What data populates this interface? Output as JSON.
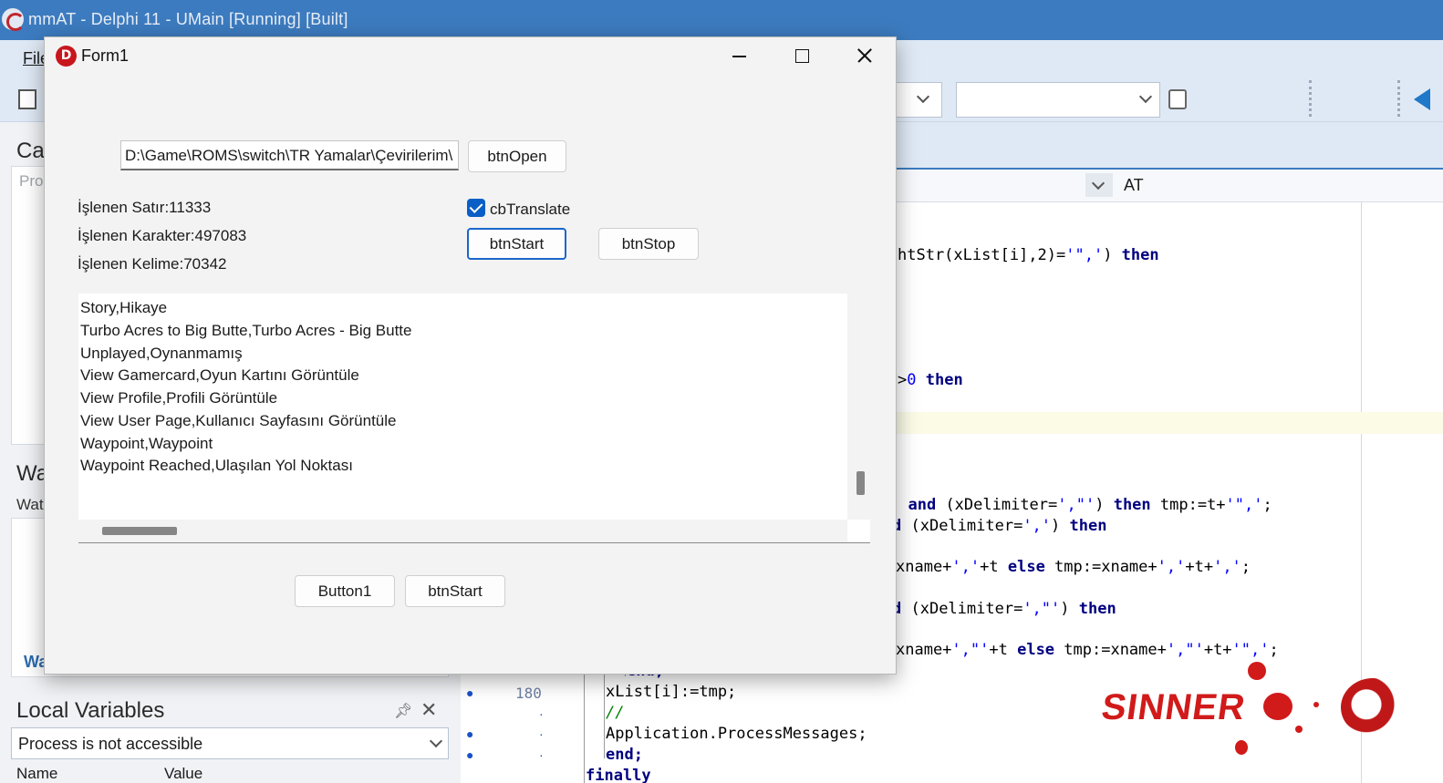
{
  "ide": {
    "title": "mmAT - Delphi 11 - UMain [Running] [Built]",
    "menu": {
      "file": "File"
    },
    "left_panel": {
      "cal_label": "Cal",
      "cal_placeholder": "Pro",
      "wa_label": "Wa",
      "wat_label": "Wat",
      "wa_tab": "Wa",
      "local_variables_title": "Local Variables",
      "process_status": "Process is not accessible",
      "col_name": "Name",
      "col_value": "Value"
    },
    "editor": {
      "nav_value": "AT",
      "line_number": "180",
      "code": {
        "l1_a": "htStr(xList[i],2)=",
        "l1_b": "'\",'",
        "l1_c": ") ",
        "l1_d": "then",
        "l2_a": ">",
        "l2_b": "0",
        "l2_c": " ",
        "l2_d": "then",
        "l3_a": ") ",
        "l3_b": "and",
        "l3_c": " (xDelimiter=",
        "l3_d": "',\"'",
        "l3_e": ") ",
        "l3_f": "then",
        "l3_g": " tmp:=t+",
        "l3_h": "'\",'",
        "l3_i": ";",
        "l4_a": "d",
        "l4_b": " (xDelimiter=",
        "l4_c": "','",
        "l4_d": ") ",
        "l4_e": "then",
        "l5_a": "xname+",
        "l5_b": "','",
        "l5_c": "+t ",
        "l5_d": "else",
        "l5_e": " tmp:=xname+",
        "l5_f": "','",
        "l5_g": "+t+",
        "l5_h": "','",
        "l5_i": ";",
        "l6_a": "d",
        "l6_b": " (xDelimiter=",
        "l6_c": "',\"'",
        "l6_d": ") ",
        "l6_e": "then",
        "l7_a": "xname+",
        "l7_b": "',\"'",
        "l7_c": "+t ",
        "l7_d": "else",
        "l7_e": " tmp:=xname+",
        "l7_f": "',\"'",
        "l7_g": "+t+",
        "l7_h": "'\",'",
        "l7_i": ";",
        "l8": "end;",
        "l9": "xList[i]:=tmp;",
        "l10": "//",
        "l11": "Application.ProcessMessages;",
        "l12": "end;",
        "l13": "finally"
      }
    },
    "watermark": "SINNER",
    "colors": {
      "ide_title": "#3c7bbf",
      "keyword": "#000080",
      "string": "#0000ff",
      "comment": "#008000",
      "accent": "#1a66c9"
    }
  },
  "form": {
    "title": "Form1",
    "path_value": "D:\\Game\\ROMS\\switch\\TR Yamalar\\Çevirilerim\\",
    "btn_open": "btnOpen",
    "label_lines": "İşlenen Satır:11333",
    "label_chars": "İşlenen Karakter:497083",
    "label_words": "İşlenen Kelime:70342",
    "cb_translate": "cbTranslate",
    "cb_translate_checked": true,
    "btn_start": "btnStart",
    "btn_stop": "btnStop",
    "memo_lines": [
      "Story,Hikaye",
      "Turbo Acres to Big Butte,Turbo Acres - Big Butte",
      "Unplayed,Oynanmamış",
      "View Gamercard,Oyun Kartını Görüntüle",
      "View Profile,Profili Görüntüle",
      "View User Page,Kullanıcı Sayfasını Görüntüle",
      "Waypoint,Waypoint",
      "Waypoint Reached,Ulaşılan Yol Noktası"
    ],
    "button1": "Button1",
    "btn_start2": "btnStart"
  }
}
